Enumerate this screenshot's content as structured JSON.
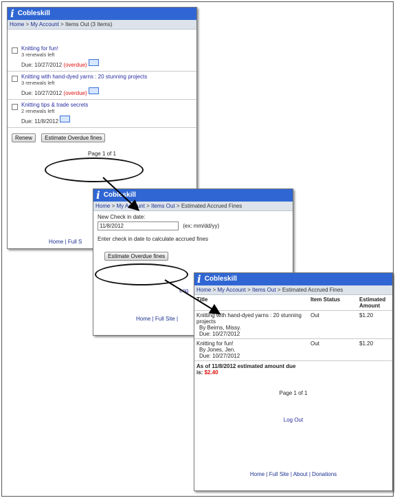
{
  "app": {
    "name": "Cobleskill"
  },
  "screen1": {
    "breadcrumb": {
      "home": "Home",
      "sep": ">",
      "my_account": "My Account",
      "current": "Items Out (3 Items)"
    },
    "items": [
      {
        "title": "Knitting for fun!",
        "renewals": "3 renewals left",
        "due_label": "Due: 10/27/2012",
        "overdue": "(overdue)"
      },
      {
        "title": "Knitting with hand-dyed yarns : 20 stunning projects",
        "renewals": "3 renewals left",
        "due_label": "Due: 10/27/2012",
        "overdue": "(overdue)"
      },
      {
        "title": "Knitting tips & trade secrets",
        "renewals": "2 renewals left",
        "due_label": "Due: 11/8/2012",
        "overdue": ""
      }
    ],
    "renew_button": "Renew",
    "estimate_button": "Estimate Overdue fines",
    "pager": "Page 1 of 1",
    "footer": "Home | Full S"
  },
  "screen2": {
    "breadcrumb": {
      "home": "Home",
      "sep": ">",
      "my_account": "My Account",
      "items_out": "Items Out",
      "current": "Estimated Accrued Fines"
    },
    "checkin_label": "New Check in date:",
    "date_value": "11/8/2012",
    "date_hint": "(ex: mm/dd/yy)",
    "instruction": "Enter check in date to calculate accrued fines",
    "estimate_button": "Estimate Overdue fines",
    "logout_partial": "Log",
    "footer": "Home | Full Site |"
  },
  "screen3": {
    "breadcrumb": {
      "home": "Home",
      "sep": ">",
      "my_account": "My Account",
      "items_out": "Items Out",
      "current": "Estimated Accrued Fines"
    },
    "columns": {
      "title": "Title",
      "status": "Item Status",
      "amount": "Estimated Amount"
    },
    "rows": [
      {
        "title": "Knitting with hand-dyed yarns : 20 stunning projects",
        "author": "By Beirns, Missy.",
        "due": "Due: 10/27/2012",
        "status": "Out",
        "amount": "$1.20"
      },
      {
        "title": "Knitting for fun!",
        "author": "By Jones, Jen.",
        "due": "Due: 10/27/2012",
        "status": "Out",
        "amount": "$1.20"
      }
    ],
    "total_label": "As of 11/8/2012 estimated amount due is:",
    "total_amount": "$2.40",
    "pager": "Page 1 of 1",
    "logout": "Log Out",
    "footer": "Home | Full Site | About | Donations"
  },
  "colors": {
    "header_blue": "#2f66d3",
    "overdue_red": "#d11111",
    "link_blue": "#2a2ea0"
  }
}
